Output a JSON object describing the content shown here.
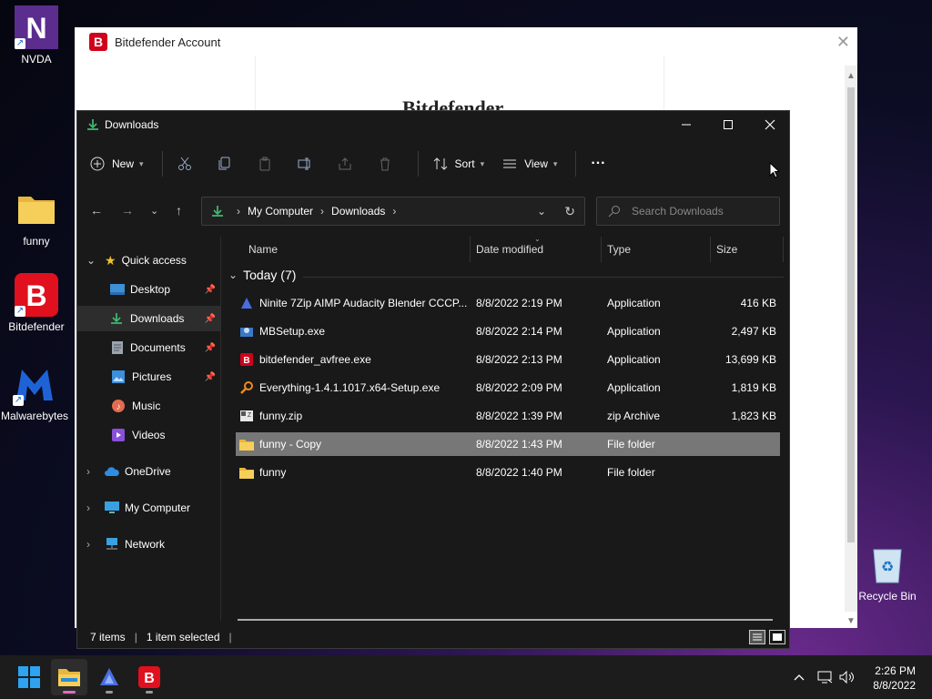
{
  "desktop": {
    "icons": [
      {
        "label": "NVDA"
      },
      {
        "label": "funny"
      },
      {
        "label": "Bitdefender"
      },
      {
        "label": "Malwarebytes"
      },
      {
        "label": "Recycle Bin"
      }
    ]
  },
  "bitdefender_window": {
    "title": "Bitdefender Account",
    "brand": "Bitdefender"
  },
  "explorer": {
    "title": "Downloads",
    "toolbar": {
      "new_label": "New",
      "sort_label": "Sort",
      "view_label": "View",
      "more_label": "···"
    },
    "address": {
      "segments": [
        "My Computer",
        "Downloads"
      ]
    },
    "search": {
      "placeholder": "Search Downloads"
    },
    "sidebar": {
      "quick_access": "Quick access",
      "items": [
        {
          "label": "Desktop"
        },
        {
          "label": "Downloads"
        },
        {
          "label": "Documents"
        },
        {
          "label": "Pictures"
        },
        {
          "label": "Music"
        },
        {
          "label": "Videos"
        }
      ],
      "roots": [
        {
          "label": "OneDrive"
        },
        {
          "label": "My Computer"
        },
        {
          "label": "Network"
        }
      ]
    },
    "columns": {
      "name": "Name",
      "date": "Date modified",
      "type": "Type",
      "size": "Size"
    },
    "group": {
      "label": "Today (7)"
    },
    "files": [
      {
        "name": "Ninite 7Zip AIMP Audacity Blender CCCP...",
        "date": "8/8/2022 2:19 PM",
        "type": "Application",
        "size": "416 KB"
      },
      {
        "name": "MBSetup.exe",
        "date": "8/8/2022 2:14 PM",
        "type": "Application",
        "size": "2,497 KB"
      },
      {
        "name": "bitdefender_avfree.exe",
        "date": "8/8/2022 2:13 PM",
        "type": "Application",
        "size": "13,699 KB"
      },
      {
        "name": "Everything-1.4.1.1017.x64-Setup.exe",
        "date": "8/8/2022 2:09 PM",
        "type": "Application",
        "size": "1,819 KB"
      },
      {
        "name": "funny.zip",
        "date": "8/8/2022 1:39 PM",
        "type": "zip Archive",
        "size": "1,823 KB"
      },
      {
        "name": "funny - Copy",
        "date": "8/8/2022 1:43 PM",
        "type": "File folder",
        "size": ""
      },
      {
        "name": "funny",
        "date": "8/8/2022 1:40 PM",
        "type": "File folder",
        "size": ""
      }
    ],
    "status": {
      "items": "7 items",
      "selected": "1 item selected"
    }
  },
  "taskbar": {
    "time": "2:26 PM",
    "date": "8/8/2022"
  }
}
